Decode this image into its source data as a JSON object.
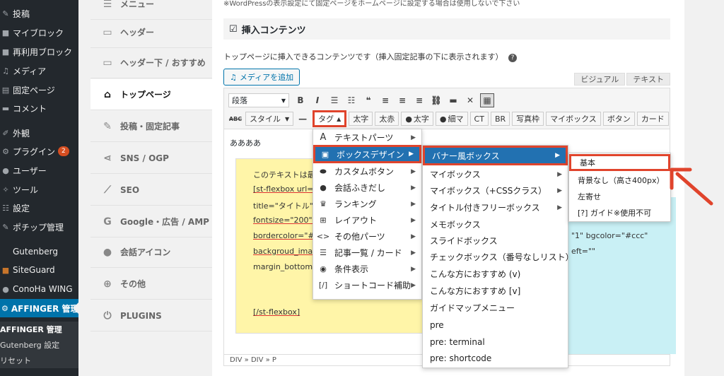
{
  "wp_sidebar": {
    "items": [
      {
        "label": "投稿",
        "icon": "pin-icon"
      },
      {
        "label": "マイブロック",
        "icon": "block-icon"
      },
      {
        "label": "再利用ブロック",
        "icon": "reuse-icon"
      },
      {
        "label": "メディア",
        "icon": "media-icon"
      },
      {
        "label": "固定ページ",
        "icon": "page-icon"
      },
      {
        "label": "コメント",
        "icon": "comment-icon"
      },
      {
        "label": "外観",
        "icon": "brush-icon"
      },
      {
        "label": "プラグイン",
        "icon": "plugin-icon",
        "badge": "2"
      },
      {
        "label": "ユーザー",
        "icon": "user-icon"
      },
      {
        "label": "ツール",
        "icon": "wrench-icon"
      },
      {
        "label": "設定",
        "icon": "settings-icon"
      },
      {
        "label": "ポチップ管理",
        "icon": "pochipp-icon"
      },
      {
        "label": "Gutenberg",
        "icon": "gutenberg-icon"
      },
      {
        "label": "SiteGuard",
        "icon": "shield-icon"
      },
      {
        "label": "ConoHa WING",
        "icon": "conoha-icon"
      },
      {
        "label": "AFFINGER 管理",
        "icon": "affinger-icon"
      }
    ],
    "subitems": [
      "AFFINGER 管理",
      "Gutenberg 設定",
      "リセット"
    ]
  },
  "settings_nav": {
    "items": [
      {
        "label": "メニュー",
        "icon": "menu-icon"
      },
      {
        "label": "ヘッダー",
        "icon": "header-icon"
      },
      {
        "label": "ヘッダー下 / おすすめ",
        "icon": "header-below-icon"
      },
      {
        "label": "トップページ",
        "icon": "home-icon"
      },
      {
        "label": "投稿・固定記事",
        "icon": "edit-icon"
      },
      {
        "label": "SNS / OGP",
        "icon": "share-icon"
      },
      {
        "label": "SEO",
        "icon": "chart-icon"
      },
      {
        "label": "Google・広告 / AMP",
        "icon": "google-icon"
      },
      {
        "label": "会話アイコン",
        "icon": "chat-icon"
      },
      {
        "label": "その他",
        "icon": "plus-icon"
      },
      {
        "label": "PLUGINS",
        "icon": "plug-icon"
      }
    ]
  },
  "content": {
    "top_note": "※WordPressの表示設定にて固定ページをホームページに設定する場合は使用しないで下さい",
    "section_title": "挿入コンテンツ",
    "description": "トップページに挿入できるコンテンツです（挿入固定記事の下に表示されます）",
    "add_media": "メディアを追加",
    "tab_visual": "ビジュアル",
    "tab_text": "テキスト"
  },
  "toolbar": {
    "format_select": "段落",
    "row2_buttons": {
      "style": "スタイル",
      "tag": "タグ",
      "bold_text": "太字",
      "bold_char": "太赤",
      "circle_bold": "太字",
      "thin_marker": "細マ",
      "ct": "CT",
      "br": "BR",
      "photo_frame": "写真枠",
      "mybox": "マイボックス",
      "button": "ボタン",
      "card": "カード"
    }
  },
  "editor": {
    "first_line": "ああああ",
    "yellow_lines": [
      "このテキストは最後に",
      "[st-flexbox url=\"\" ",
      "title=\"タイトル\" wid",
      "fontsize=\"200\" radi",
      "bordercolor=\"#ccc\"",
      "backgroud_image=\"",
      "margin_bottom=\"0\""
    ],
    "closing_tag": "[/st-flexbox]",
    "cyan_lines": [
      "\"1\" bgcolor=\"#ccc\"",
      "eft=\"\""
    ],
    "statusbar": "DIV » DIV » P"
  },
  "menu_level1": [
    {
      "label": "テキストパーツ",
      "icon": "text-a-icon"
    },
    {
      "label": "ボックスデザイン",
      "icon": "box-icon",
      "highlighted": true
    },
    {
      "label": "カスタムボタン",
      "icon": "toggle-icon"
    },
    {
      "label": "会話ふきだし",
      "icon": "speech-icon"
    },
    {
      "label": "ランキング",
      "icon": "crown-icon"
    },
    {
      "label": "レイアウト",
      "icon": "grid-icon"
    },
    {
      "label": "その他パーツ",
      "icon": "code-icon"
    },
    {
      "label": "記事一覧 / カード",
      "icon": "list-icon"
    },
    {
      "label": "条件表示",
      "icon": "eye-icon"
    },
    {
      "label": "ショートコード補助",
      "icon": "bracket-icon"
    }
  ],
  "menu_level2": [
    {
      "label": "バナー風ボックス",
      "highlighted": true,
      "submenu": true
    },
    {
      "label": "マイボックス",
      "submenu": true
    },
    {
      "label": "マイボックス（+CSSクラス）",
      "submenu": true
    },
    {
      "label": "タイトル付きフリーボックス",
      "submenu": true
    },
    {
      "label": "メモボックス"
    },
    {
      "label": "スライドボックス"
    },
    {
      "label": "チェックボックス（番号なしリスト）"
    },
    {
      "label": "こんな方におすすめ (v)"
    },
    {
      "label": "こんな方におすすめ [v]"
    },
    {
      "label": "ガイドマップメニュー"
    },
    {
      "label": "pre"
    },
    {
      "label": "pre: terminal"
    },
    {
      "label": "pre: shortcode"
    }
  ],
  "menu_level3": [
    {
      "label": "基本",
      "boxed": true
    },
    {
      "label": "背景なし（高さ400px）"
    },
    {
      "label": "左寄せ"
    },
    {
      "label": "[?] ガイド※使用不可"
    }
  ],
  "colors": {
    "highlight": "#2271b1",
    "annotation": "#e0442c",
    "wp_active": "#0073aa"
  }
}
